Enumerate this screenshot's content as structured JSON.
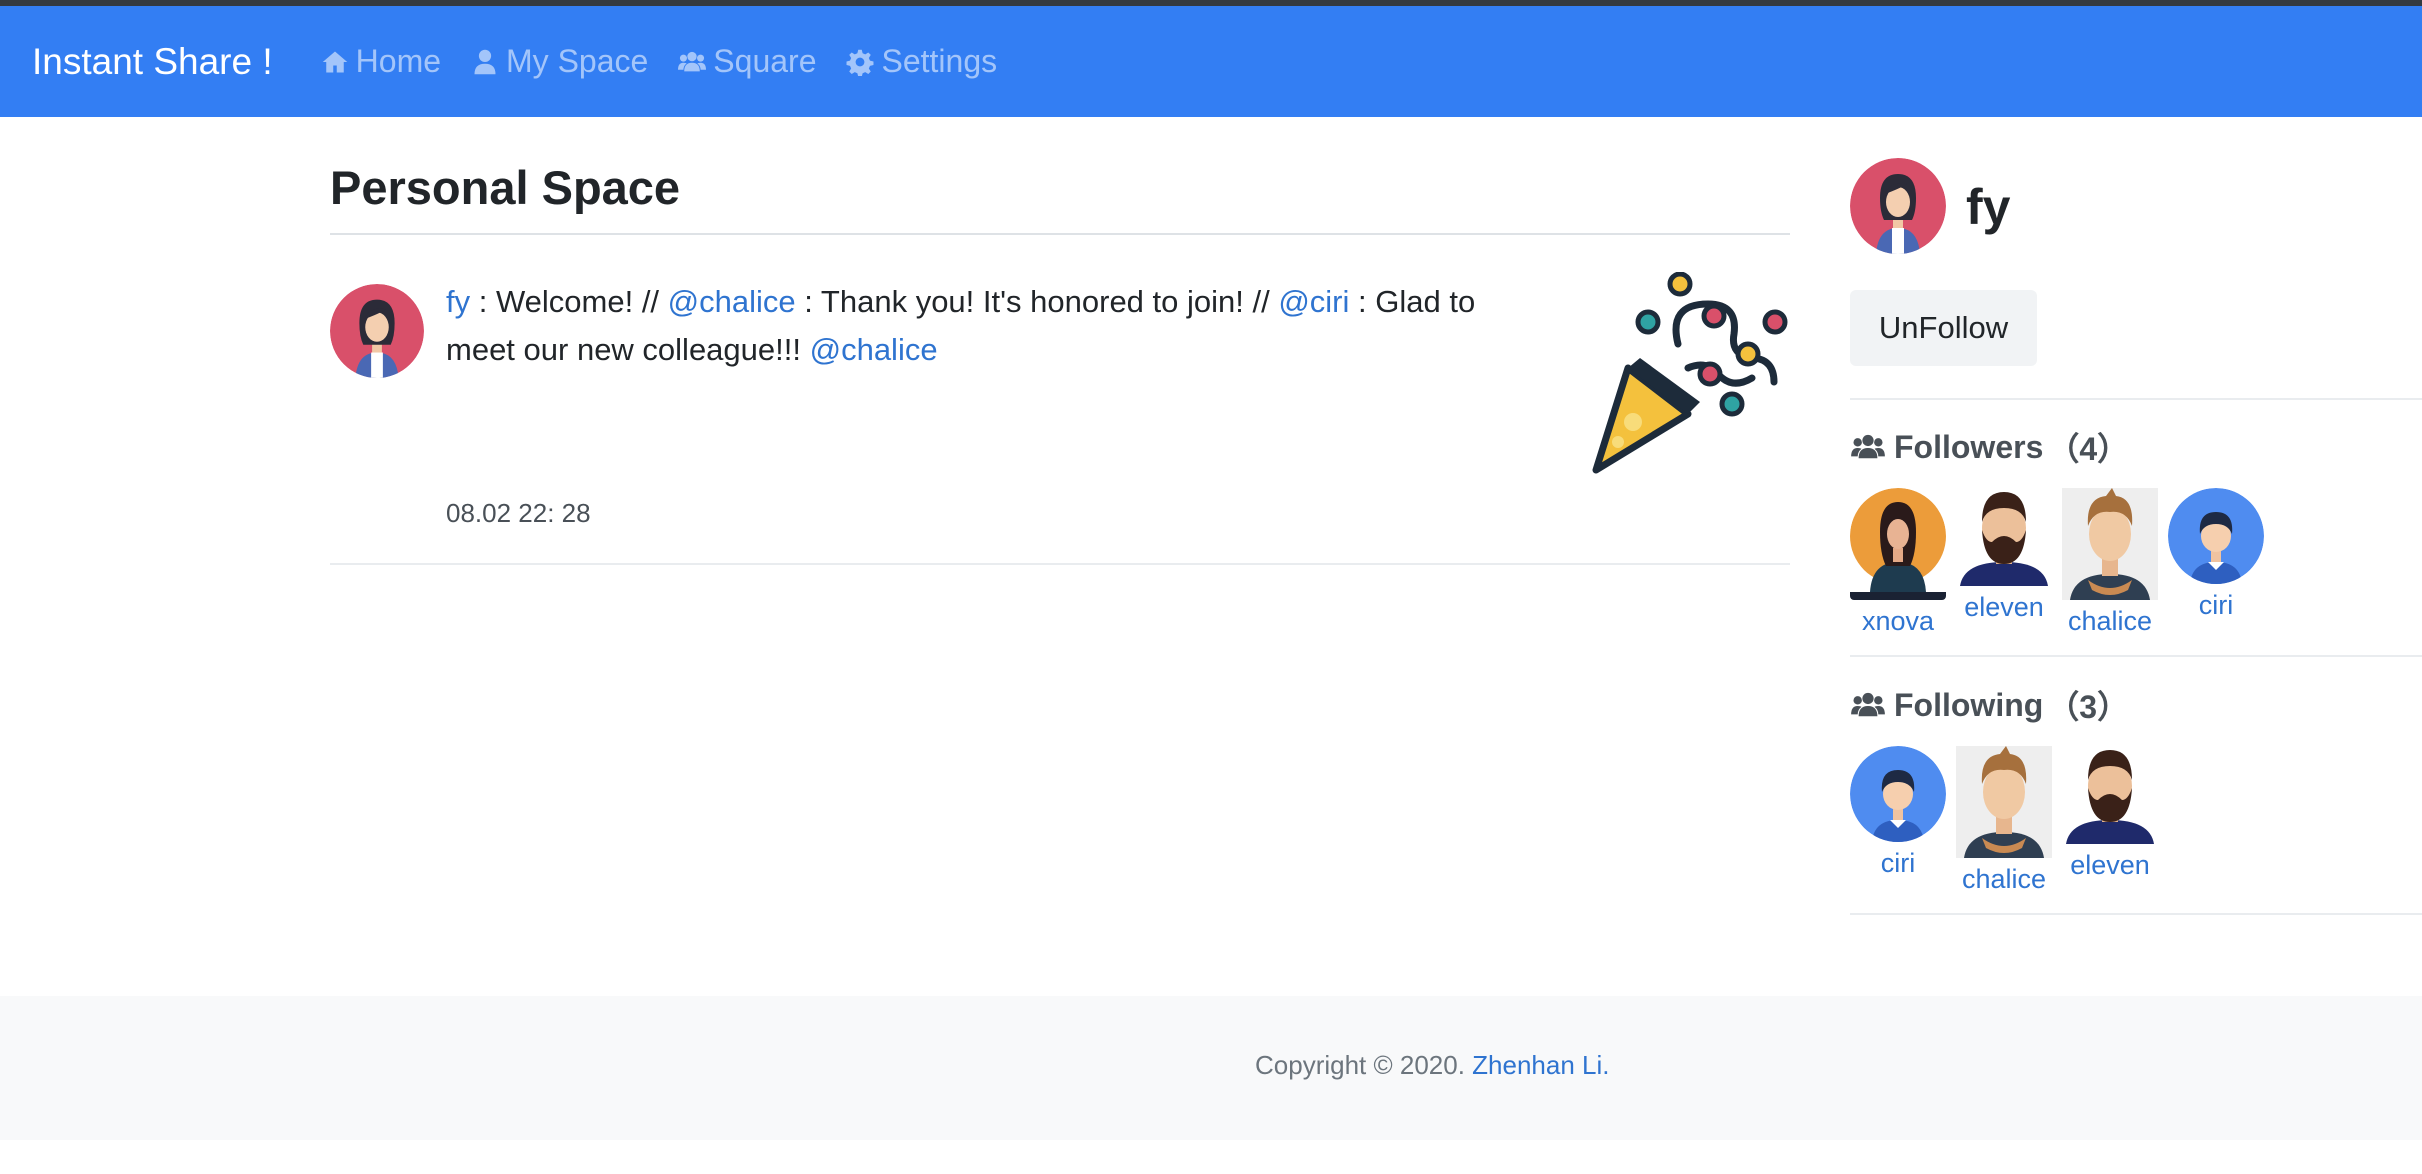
{
  "navbar": {
    "brand": "Instant Share !",
    "items": [
      {
        "label": "Home",
        "icon": "home-icon"
      },
      {
        "label": "My Space",
        "icon": "user-icon"
      },
      {
        "label": "Square",
        "icon": "users-icon"
      },
      {
        "label": "Settings",
        "icon": "gear-icon"
      }
    ]
  },
  "main": {
    "title": "Personal Space",
    "post": {
      "author": "fy",
      "segments": [
        {
          "text": " : Welcome! // ",
          "link": false
        },
        {
          "text": "@chalice",
          "link": true
        },
        {
          "text": " : Thank you! It's honored to join! // ",
          "link": false
        },
        {
          "text": "@ciri",
          "link": true
        },
        {
          "text": " : Glad to meet our new colleague!!! ",
          "link": false
        },
        {
          "text": "@chalice",
          "link": true
        }
      ],
      "time": "08.02 22: 28",
      "image_icon": "party-popper-icon"
    }
  },
  "sidebar": {
    "username": "fy",
    "unfollow_label": "UnFollow",
    "followers": {
      "label": "Followers",
      "count": "（4）",
      "users": [
        "xnova",
        "eleven",
        "chalice",
        "ciri"
      ]
    },
    "following": {
      "label": "Following",
      "count": "（3）",
      "users": [
        "ciri",
        "chalice",
        "eleven"
      ]
    }
  },
  "footer": {
    "copyright": "Copyright © 2020. ",
    "author": "Zhenhan Li."
  },
  "colors": {
    "navbar": "#337ef3",
    "link": "#2f74d0",
    "footer_bg": "#f8f9fa"
  }
}
